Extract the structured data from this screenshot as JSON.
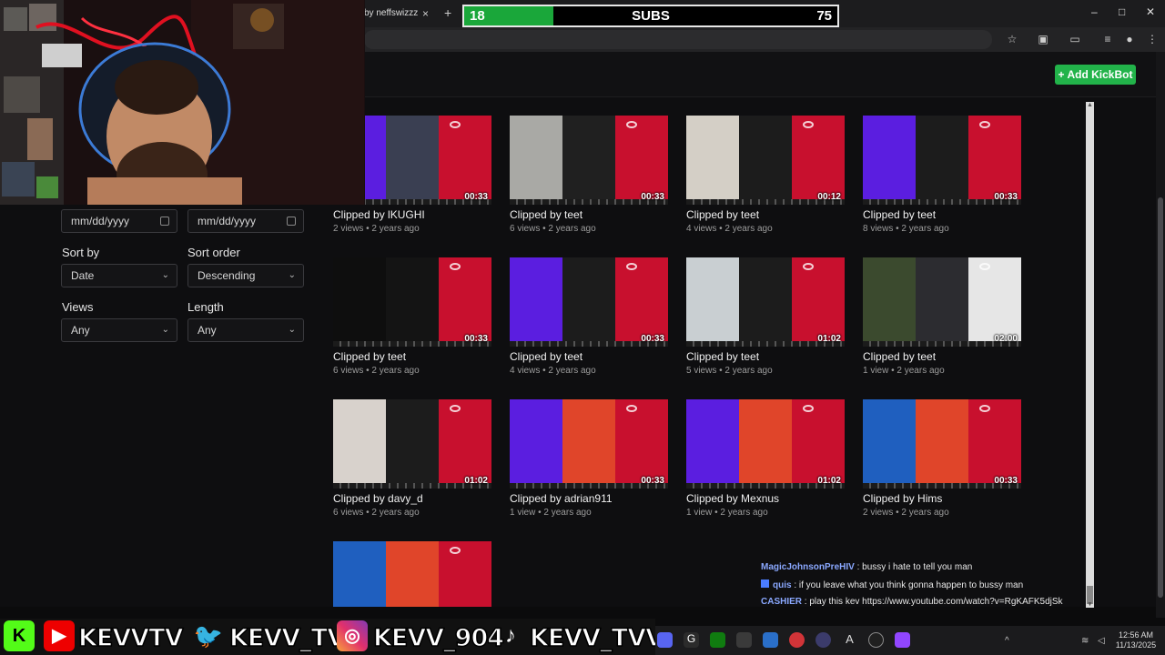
{
  "browser": {
    "tab_title": "by neffswizzz",
    "tab_close": "×",
    "new_tab": "+",
    "window_controls": [
      "–",
      "□",
      "✕"
    ],
    "toolbar_icons": [
      "star-icon",
      "extensions-icon",
      "cast-icon",
      "queue-icon",
      "profile-icon",
      "menu-icon"
    ]
  },
  "subs_overlay": {
    "current": "18",
    "label": "SUBS",
    "goal": "75",
    "progress_fraction": 0.24,
    "fill_color": "#1aa73a"
  },
  "page": {
    "add_button": "+ Add KickBot",
    "accent": "#22b34a"
  },
  "filters": {
    "date_from_placeholder": "mm/dd/yyyy",
    "date_to_placeholder": "mm/dd/yyyy",
    "sort_by_label": "Sort by",
    "sort_by_value": "Date",
    "sort_order_label": "Sort order",
    "sort_order_value": "Descending",
    "views_label": "Views",
    "views_value": "Any",
    "length_label": "Length",
    "length_value": "Any"
  },
  "clips": [
    {
      "title": "Clipped by lKUGHI",
      "meta": "2 views • 2 years ago",
      "duration": "00:33",
      "palette": [
        "#5b1ee0",
        "#3a3f52",
        "#c8102e"
      ]
    },
    {
      "title": "Clipped by teet",
      "meta": "6 views • 2 years ago",
      "duration": "00:33",
      "palette": [
        "#a9a9a5",
        "#202020",
        "#c8102e"
      ]
    },
    {
      "title": "Clipped by teet",
      "meta": "4 views • 2 years ago",
      "duration": "00:12",
      "palette": [
        "#d4cfc6",
        "#1c1c1c",
        "#c8102e"
      ]
    },
    {
      "title": "Clipped by teet",
      "meta": "8 views • 2 years ago",
      "duration": "00:33",
      "palette": [
        "#5b1ee0",
        "#1c1c1c",
        "#c8102e"
      ]
    },
    {
      "title": "Clipped by teet",
      "meta": "6 views • 2 years ago",
      "duration": "00:33",
      "palette": [
        "#0e0e0e",
        "#141414",
        "#c8102e"
      ]
    },
    {
      "title": "Clipped by teet",
      "meta": "4 views • 2 years ago",
      "duration": "00:33",
      "palette": [
        "#5b1ee0",
        "#1c1c1c",
        "#c8102e"
      ]
    },
    {
      "title": "Clipped by teet",
      "meta": "5 views • 2 years ago",
      "duration": "01:02",
      "palette": [
        "#c9cfd2",
        "#1c1c1c",
        "#c8102e"
      ]
    },
    {
      "title": "Clipped by teet",
      "meta": "1 view • 2 years ago",
      "duration": "02:00",
      "palette": [
        "#3b4a2e",
        "#2c2c30",
        "#e6e6e6"
      ]
    },
    {
      "title": "Clipped by davy_d",
      "meta": "6 views • 2 years ago",
      "duration": "01:02",
      "palette": [
        "#d8d2cc",
        "#1c1c1c",
        "#c8102e"
      ]
    },
    {
      "title": "Clipped by adrian911",
      "meta": "1 view • 2 years ago",
      "duration": "00:33",
      "palette": [
        "#5b1ee0",
        "#e0452a",
        "#c8102e"
      ]
    },
    {
      "title": "Clipped by Mexnus",
      "meta": "1 view • 2 years ago",
      "duration": "01:02",
      "palette": [
        "#5b1ee0",
        "#e0452a",
        "#c8102e"
      ]
    },
    {
      "title": "Clipped by Hims",
      "meta": "2 views • 2 years ago",
      "duration": "00:33",
      "palette": [
        "#1f5fbf",
        "#e0452a",
        "#c8102e"
      ]
    },
    {
      "title": "",
      "meta": "",
      "duration": "",
      "palette": [
        "#1f5fbf",
        "#e0452a",
        "#c8102e"
      ]
    }
  ],
  "chat": [
    {
      "user": "MagicJohnsonPreHIV",
      "user_color": "#8aa8ff",
      "text": " : bussy i hate to tell you man"
    },
    {
      "user": "quis",
      "user_color": "#8aa8ff",
      "text": " : if you leave what you think gonna happen to bussy man"
    },
    {
      "user": "CASHIER",
      "user_color": "#8aa8ff",
      "text": " : play this kev https://www.youtube.com/watch?v=RgKAFK5djSk"
    }
  ],
  "socials": {
    "kick_letter": "K",
    "handles": [
      "KEVVTV",
      "KEVV_TV",
      "KEVV_904",
      "KEVV_TVV"
    ]
  },
  "taskbar": {
    "time": "12:56 AM",
    "date": "11/13/2025",
    "chevron": "^",
    "tray_icons": [
      "wifi-icon",
      "speaker-icon"
    ]
  }
}
